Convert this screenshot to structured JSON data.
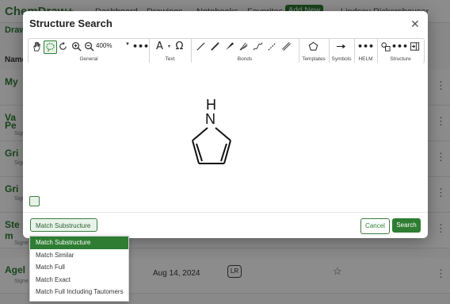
{
  "background": {
    "logo": "ChemDraw+",
    "nav": [
      "Dashboard",
      "Drawings",
      "Notebooks",
      "Favorites"
    ],
    "add_new": "Add New ▾",
    "user": "Lindsey Rickershauser",
    "subheader": "Draw",
    "name_header": "Name",
    "rows": [
      {
        "name": "My",
        "sub": ""
      },
      {
        "name": "Va",
        "name2": "Pe",
        "sub": "Signe"
      },
      {
        "name": "Gri",
        "sub": "Signe"
      },
      {
        "name": "Gri",
        "sub": "Signe"
      },
      {
        "name": "Ste",
        "name2": "m",
        "sub": "Signe"
      },
      {
        "name": "Agel",
        "sub": "Signe",
        "date": "Aug 14, 2024",
        "badge": "LR"
      }
    ]
  },
  "modal": {
    "title": "Structure Search",
    "close_icon": "close-icon",
    "toolbar": {
      "zoom_value": "400%",
      "groups": {
        "general": "General",
        "text": "Text",
        "bonds": "Bonds",
        "templates": "Templates",
        "symbols": "Symbols",
        "helm": "HELM",
        "structure": "Structure"
      }
    },
    "molecule": {
      "name": "pyrrole",
      "atom_label": "N",
      "h_label": "H"
    },
    "match_button": "Match Substructure",
    "cancel": "Cancel",
    "search": "Search"
  },
  "dropdown": {
    "options": [
      "Match Substructure",
      "Match Similar",
      "Match Full",
      "Match Exact",
      "Match Full Including Tautomers"
    ],
    "selected": "Match Substructure"
  },
  "colors": {
    "accent": "#2e7d32",
    "accent_light": "#e7f3e8"
  }
}
